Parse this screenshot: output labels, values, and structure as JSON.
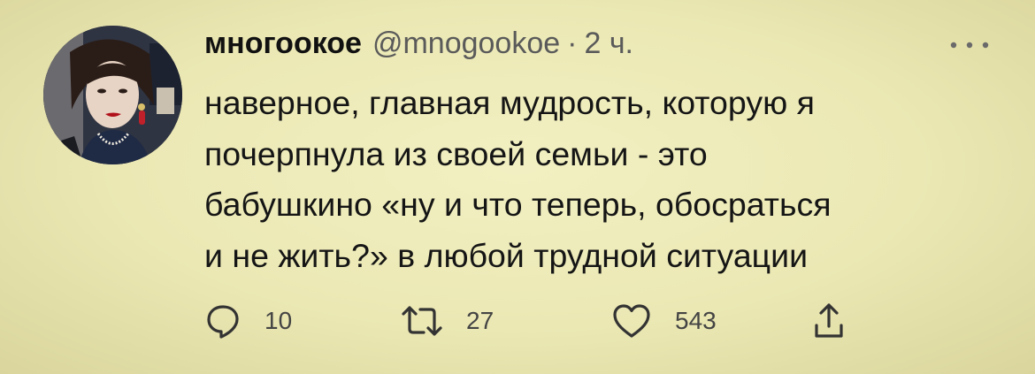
{
  "tweet": {
    "author": {
      "display_name": "многоокое",
      "handle": "@mnogookoe",
      "avatar_icon": "user-avatar-portrait"
    },
    "separator": "·",
    "time": "2 ч.",
    "text": "наверное, главная мудрость, которую я\nпочерпнула из своей семьи - это\nбабушкино «ну и что теперь, обосраться\nи не жить?» в любой трудной ситуации",
    "more_icon": "more-horizontal-icon",
    "actions": {
      "reply": {
        "icon": "comment-icon",
        "count": "10"
      },
      "retweet": {
        "icon": "retweet-icon",
        "count": "27"
      },
      "like": {
        "icon": "heart-icon",
        "count": "543"
      },
      "share": {
        "icon": "share-icon"
      }
    }
  },
  "colors": {
    "background": "#ebe8b4",
    "text": "#151515",
    "secondary_text": "#5a5a5a"
  }
}
